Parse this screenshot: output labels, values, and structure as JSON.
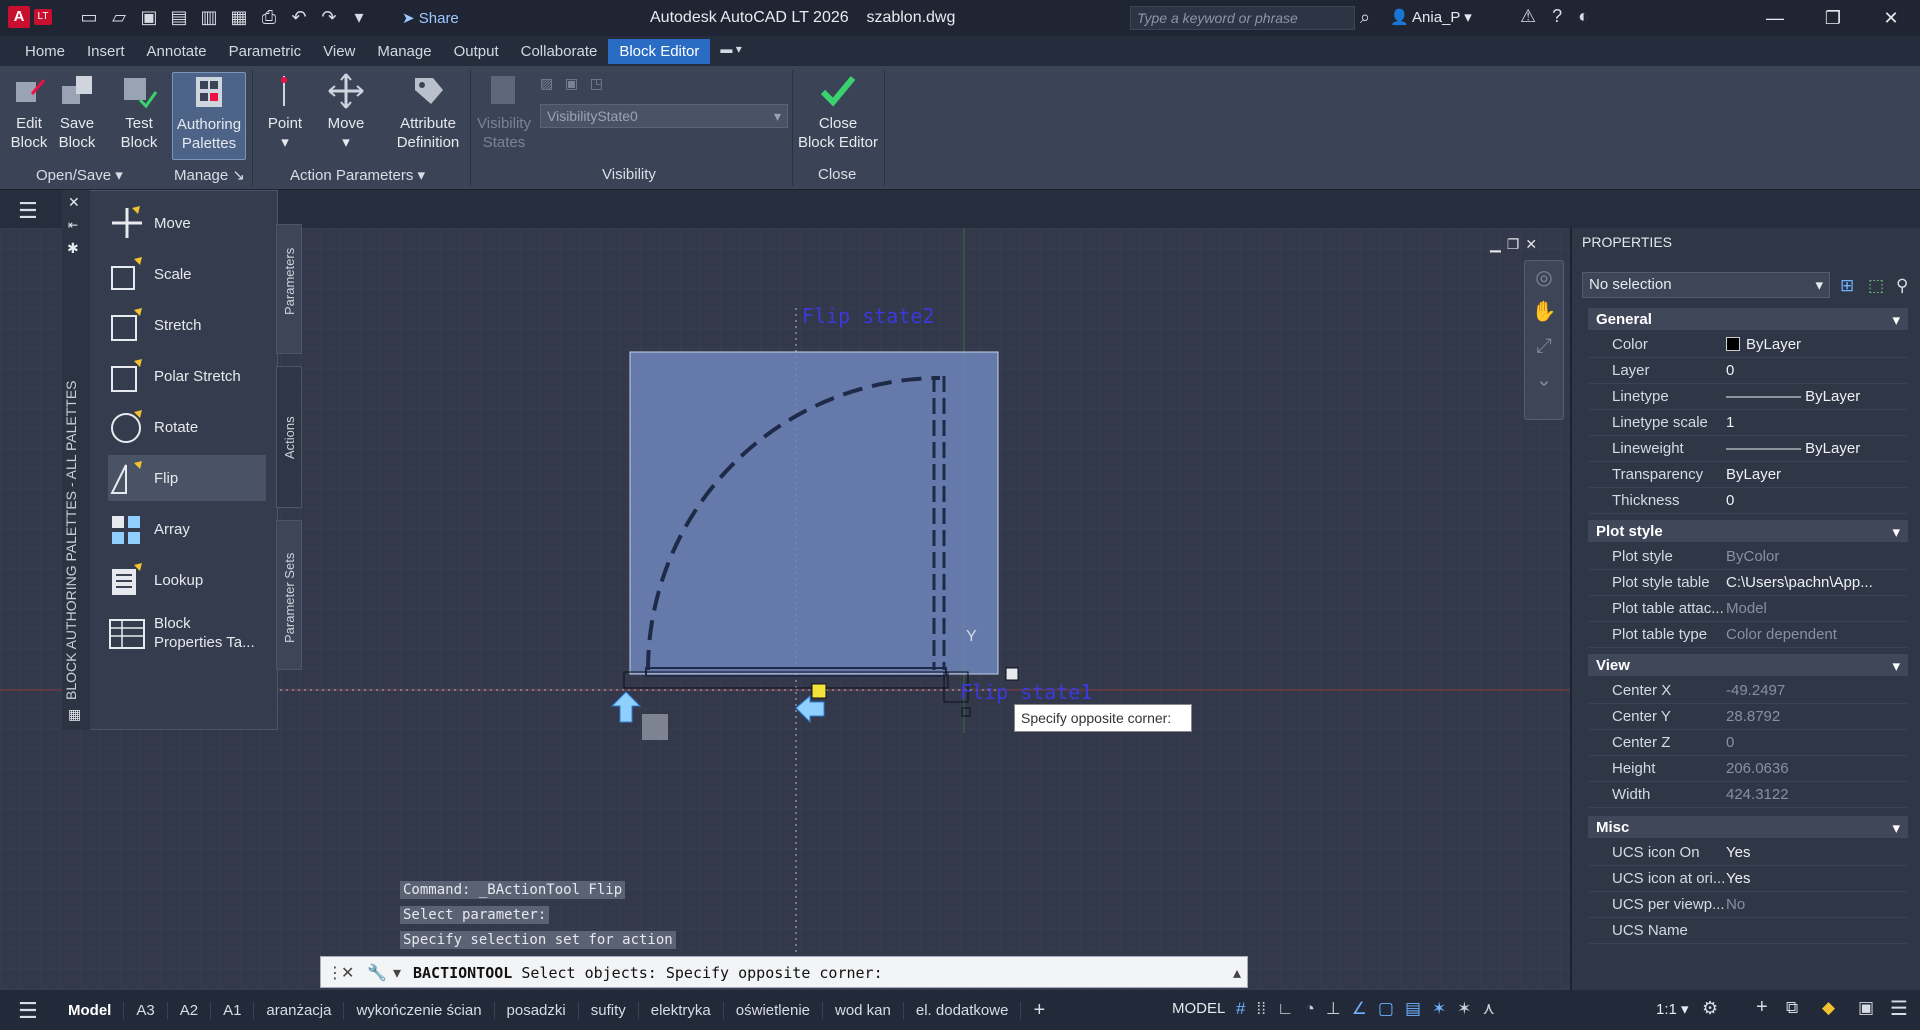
{
  "titlebar": {
    "logo": "A",
    "edition": "LT",
    "share": "Share",
    "title": "Autodesk AutoCAD LT 2026",
    "filename": "szablon.dwg",
    "search_placeholder": "Type a keyword or phrase",
    "user": "Ania_P"
  },
  "menu_tabs": [
    "Home",
    "Insert",
    "Annotate",
    "Parametric",
    "View",
    "Manage",
    "Output",
    "Collaborate",
    "Block Editor"
  ],
  "ribbon": {
    "edit_block": [
      "Edit",
      "Block"
    ],
    "save_block": [
      "Save",
      "Block"
    ],
    "test_block": [
      "Test",
      "Block"
    ],
    "authoring_palettes": [
      "Authoring",
      "Palettes"
    ],
    "point": "Point",
    "move": "Move",
    "attribute_definition": [
      "Attribute",
      "Definition"
    ],
    "visibility_states": [
      "Visibility",
      "States"
    ],
    "visibility_dropdown": "VisibilityState0",
    "close_block_editor": [
      "Close",
      "Block Editor"
    ],
    "panels": {
      "open_save": "Open/Save",
      "manage": "Manage",
      "action_parameters": "Action Parameters",
      "visibility": "Visibility",
      "close": "Close"
    }
  },
  "palette": {
    "title": "BLOCK AUTHORING PALETTES - ALL PALETTES",
    "items": [
      "Move",
      "Scale",
      "Stretch",
      "Polar Stretch",
      "Rotate",
      "Flip",
      "Array",
      "Lookup",
      "Block Properties Ta..."
    ],
    "tabs": [
      "Parameters",
      "Actions",
      "Parameter Sets"
    ]
  },
  "drawing": {
    "flip_state2": "Flip  state2",
    "flip_state1": "Flip  state1",
    "y_axis": "Y",
    "tooltip": "Specify opposite corner:"
  },
  "properties": {
    "title": "PROPERTIES",
    "selection": "No selection",
    "sections": {
      "general": "General",
      "plot_style": "Plot style",
      "view": "View",
      "misc": "Misc"
    },
    "general": [
      {
        "k": "Color",
        "v": "ByLayer"
      },
      {
        "k": "Layer",
        "v": "0"
      },
      {
        "k": "Linetype",
        "v": "ByLayer"
      },
      {
        "k": "Linetype scale",
        "v": "1"
      },
      {
        "k": "Lineweight",
        "v": "ByLayer"
      },
      {
        "k": "Transparency",
        "v": "ByLayer"
      },
      {
        "k": "Thickness",
        "v": "0"
      }
    ],
    "plot_style": [
      {
        "k": "Plot style",
        "v": "ByColor"
      },
      {
        "k": "Plot style table",
        "v": "C:\\Users\\pachn\\App..."
      },
      {
        "k": "Plot table attac...",
        "v": "Model"
      },
      {
        "k": "Plot table type",
        "v": "Color dependent"
      }
    ],
    "view": [
      {
        "k": "Center X",
        "v": "-49.2497"
      },
      {
        "k": "Center Y",
        "v": "28.8792"
      },
      {
        "k": "Center Z",
        "v": "0"
      },
      {
        "k": "Height",
        "v": "206.0636"
      },
      {
        "k": "Width",
        "v": "424.3122"
      }
    ],
    "misc": [
      {
        "k": "UCS icon On",
        "v": "Yes"
      },
      {
        "k": "UCS icon at ori...",
        "v": "Yes"
      },
      {
        "k": "UCS per viewp...",
        "v": "No"
      },
      {
        "k": "UCS Name",
        "v": ""
      }
    ]
  },
  "command": {
    "history": [
      "Command: _BActionTool Flip",
      "Select parameter:",
      "Specify selection set for action"
    ],
    "tool": "BACTIONTOOL",
    "prompt": "Select objects: Specify opposite corner:"
  },
  "status": {
    "layouts": [
      "Model",
      "A3",
      "A2",
      "A1",
      "aranżacja",
      "wykończenie ścian",
      "posadzki",
      "sufity",
      "elektryka",
      "oświetlenie",
      "wod kan",
      "el. dodatkowe"
    ],
    "model": "MODEL",
    "scale": "1:1"
  }
}
